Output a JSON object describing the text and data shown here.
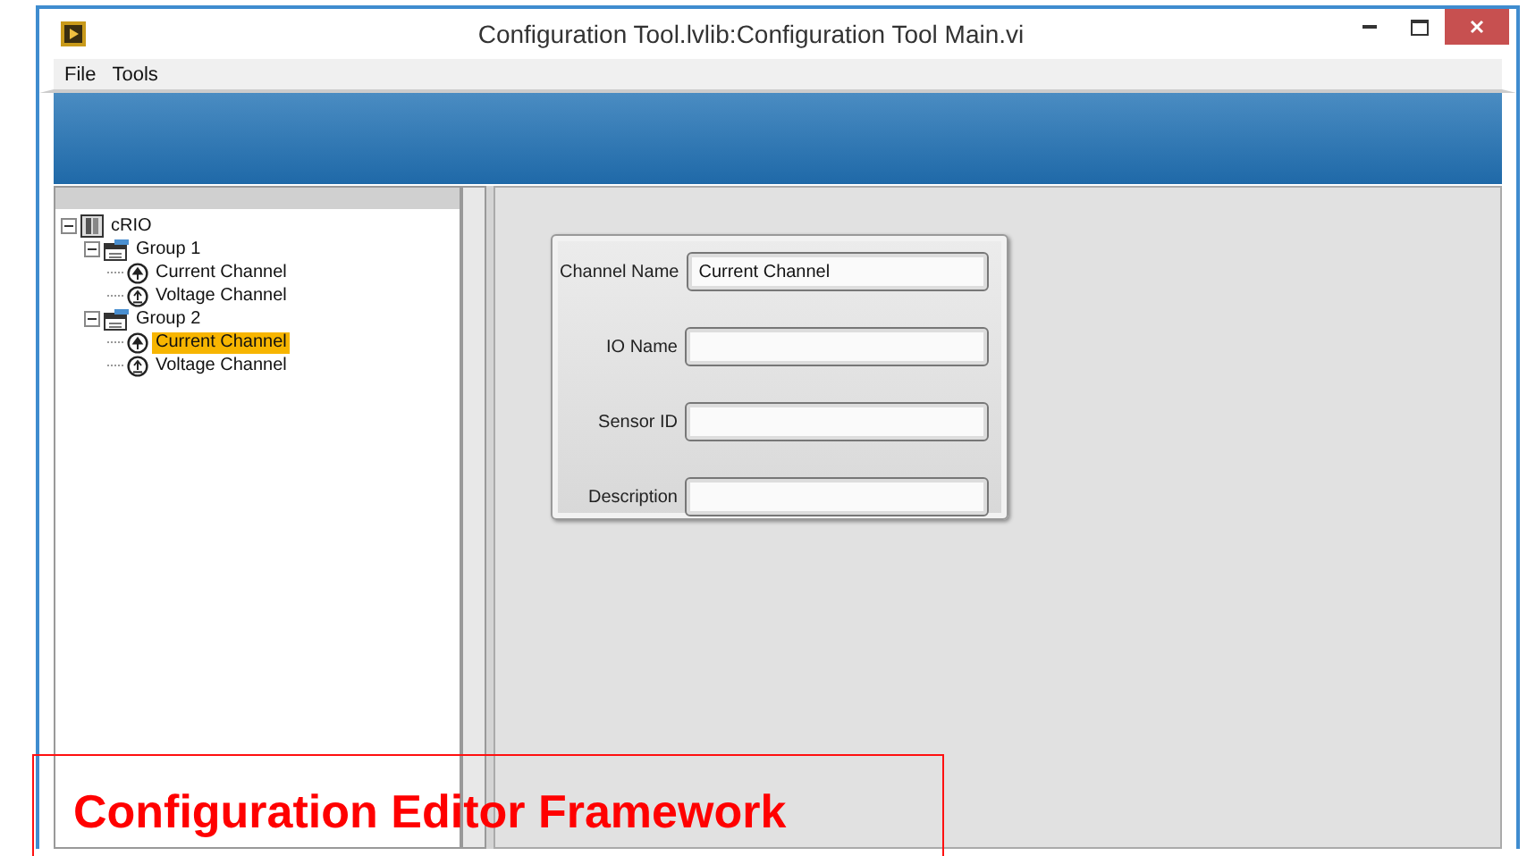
{
  "window": {
    "title": "Configuration Tool.lvlib:Configuration Tool Main.vi"
  },
  "menu": [
    "File",
    "Tools"
  ],
  "tree": [
    {
      "label": "cRIO",
      "kind": "device",
      "expanded": true,
      "selected": false,
      "children": [
        {
          "label": "Group 1",
          "kind": "group",
          "expanded": true,
          "selected": false,
          "children": [
            {
              "label": "Current Channel",
              "kind": "current",
              "selected": false
            },
            {
              "label": "Voltage Channel",
              "kind": "voltage",
              "selected": false
            }
          ]
        },
        {
          "label": "Group 2",
          "kind": "group",
          "expanded": true,
          "selected": false,
          "children": [
            {
              "label": "Current Channel",
              "kind": "current",
              "selected": true
            },
            {
              "label": "Voltage Channel",
              "kind": "voltage",
              "selected": false
            }
          ]
        }
      ]
    }
  ],
  "form": [
    {
      "label": "Channel Name",
      "value": "Current Channel"
    },
    {
      "label": "IO Name"
    },
    {
      "label": "Sensor ID"
    },
    {
      "label": "Description"
    }
  ],
  "caption": "Configuration Editor Framework"
}
